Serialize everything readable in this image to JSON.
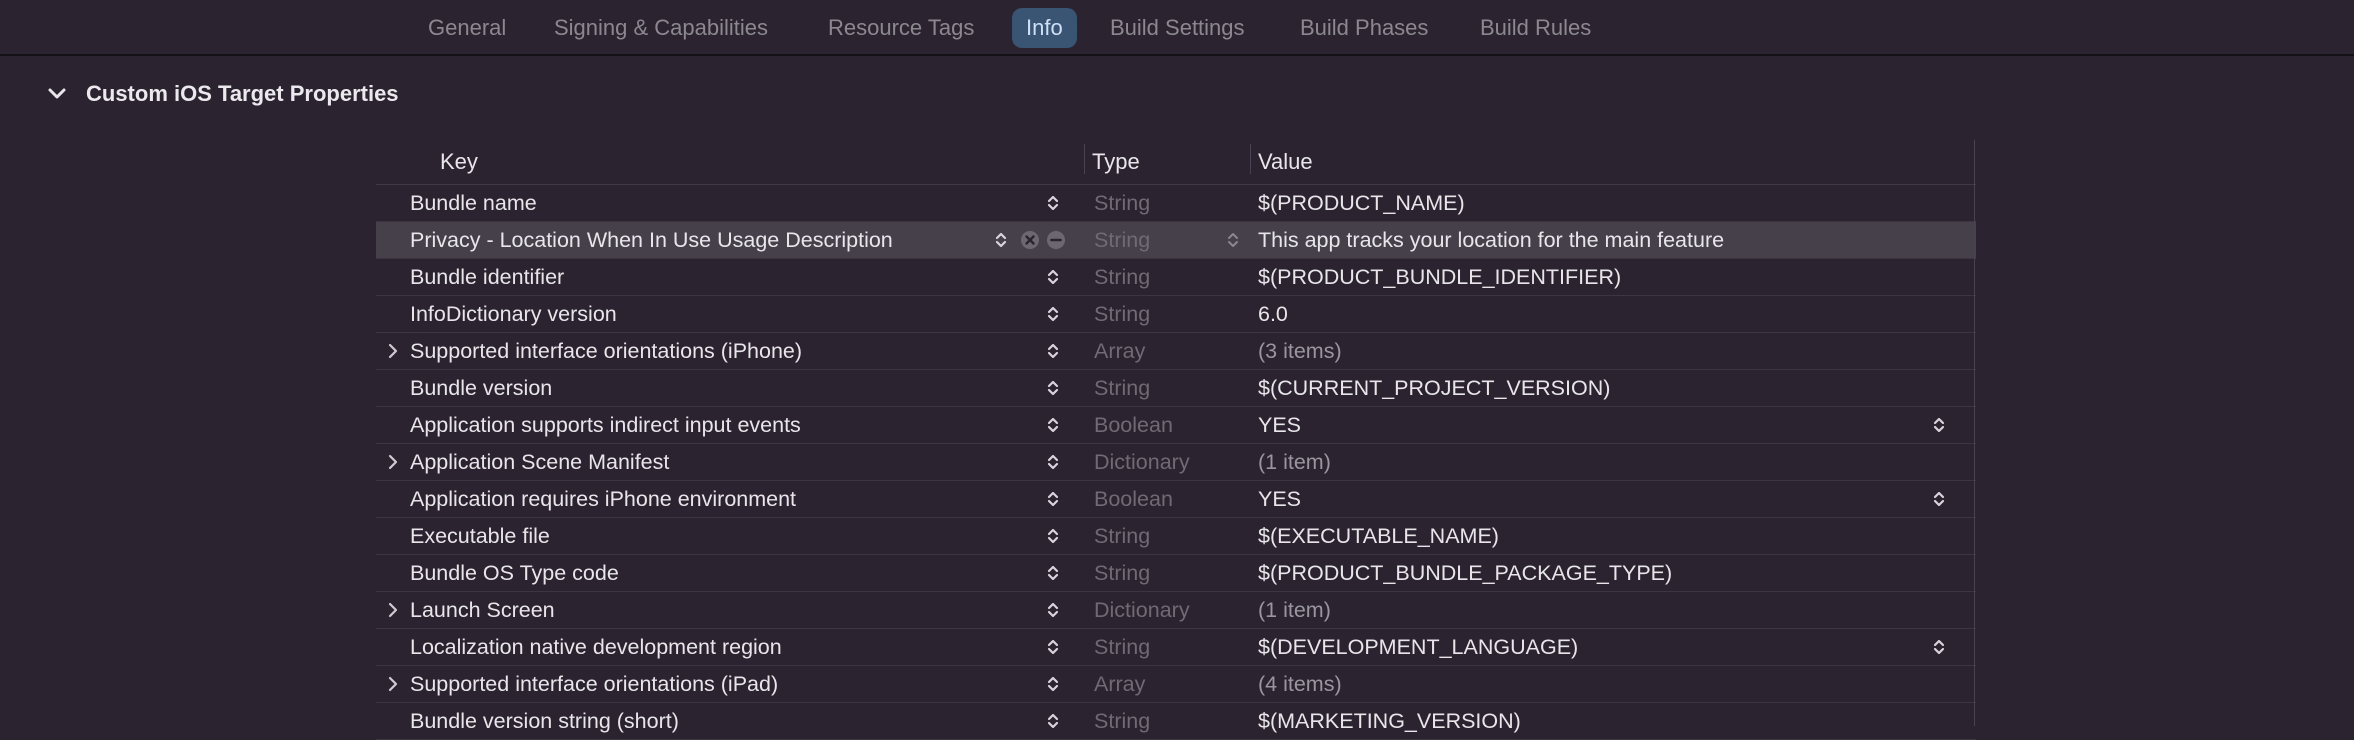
{
  "tabs": [
    {
      "label": "General",
      "active": false
    },
    {
      "label": "Signing & Capabilities",
      "active": false
    },
    {
      "label": "Resource Tags",
      "active": false
    },
    {
      "label": "Info",
      "active": true
    },
    {
      "label": "Build Settings",
      "active": false
    },
    {
      "label": "Build Phases",
      "active": false
    },
    {
      "label": "Build Rules",
      "active": false
    }
  ],
  "section": {
    "title": "Custom iOS Target Properties",
    "icon": "chevron-down-icon"
  },
  "table": {
    "headers": {
      "key": "Key",
      "type": "Type",
      "value": "Value"
    },
    "rows": [
      {
        "key": "Bundle name",
        "type": "String",
        "value": "$(PRODUCT_NAME)"
      },
      {
        "key": "Privacy - Location When In Use Usage Description",
        "type": "String",
        "value": "This app tracks your location for the main feature"
      },
      {
        "key": "Bundle identifier",
        "type": "String",
        "value": "$(PRODUCT_BUNDLE_IDENTIFIER)"
      },
      {
        "key": "InfoDictionary version",
        "type": "String",
        "value": "6.0"
      },
      {
        "key": "Supported interface orientations (iPhone)",
        "type": "Array",
        "value": "(3 items)"
      },
      {
        "key": "Bundle version",
        "type": "String",
        "value": "$(CURRENT_PROJECT_VERSION)"
      },
      {
        "key": "Application supports indirect input events",
        "type": "Boolean",
        "value": "YES"
      },
      {
        "key": "Application Scene Manifest",
        "type": "Dictionary",
        "value": "(1 item)"
      },
      {
        "key": "Application requires iPhone environment",
        "type": "Boolean",
        "value": "YES"
      },
      {
        "key": "Executable file",
        "type": "String",
        "value": "$(EXECUTABLE_NAME)"
      },
      {
        "key": "Bundle OS Type code",
        "type": "String",
        "value": "$(PRODUCT_BUNDLE_PACKAGE_TYPE)"
      },
      {
        "key": "Launch Screen",
        "type": "Dictionary",
        "value": "(1 item)"
      },
      {
        "key": "Localization native development region",
        "type": "String",
        "value": "$(DEVELOPMENT_LANGUAGE)"
      },
      {
        "key": "Supported interface orientations (iPad)",
        "type": "Array",
        "value": "(4 items)"
      },
      {
        "key": "Bundle version string (short)",
        "type": "String",
        "value": "$(MARKETING_VERSION)"
      }
    ]
  },
  "colors": {
    "background": "#2b2430",
    "selected_row": "#46404b",
    "active_tab": "#3a5474",
    "muted_text": "#6f6a74"
  }
}
